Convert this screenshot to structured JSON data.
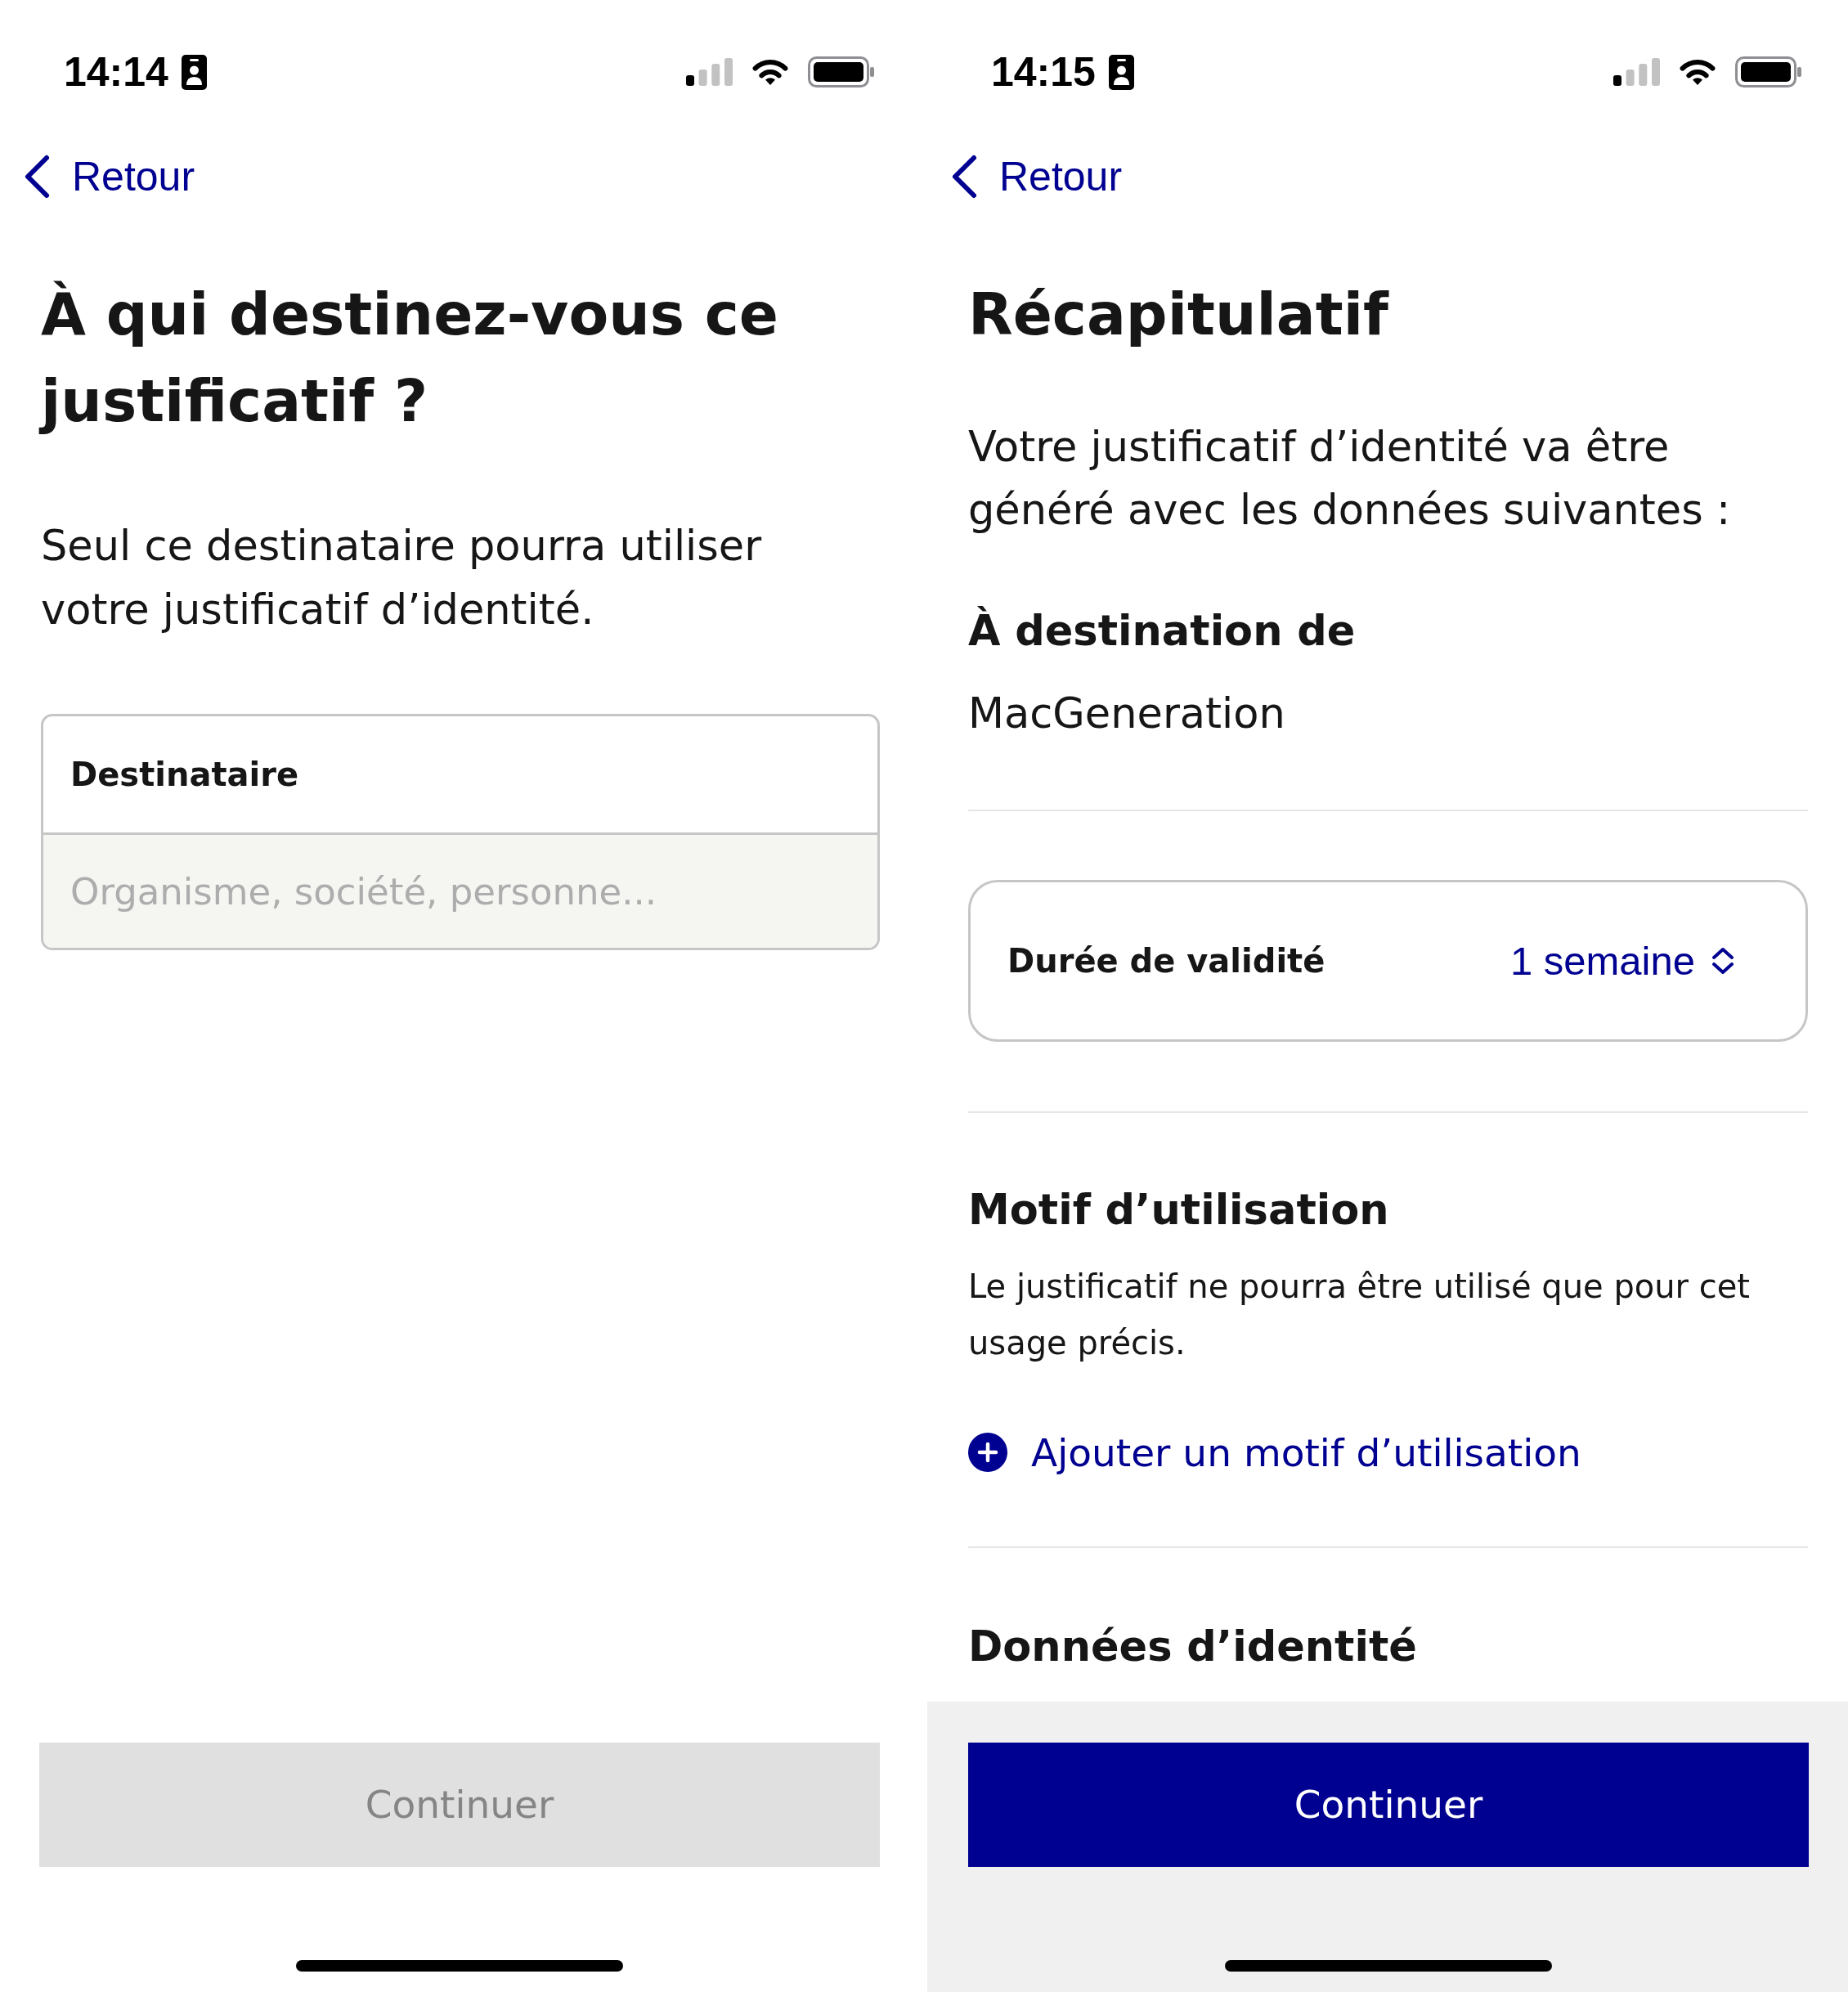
{
  "screens": [
    {
      "kind": "recipient_form",
      "status_bar": {
        "time": "14:14"
      },
      "back_link": "Retour",
      "title": "À qui destinez-vous ce justificatif ?",
      "description": "Seul ce destinataire pourra utiliser votre justificatif d’identité.",
      "field": {
        "label": "Destinataire",
        "placeholder": "Organisme, société, personne..."
      },
      "button": {
        "label": "Continuer",
        "disabled": true
      }
    },
    {
      "kind": "summary",
      "status_bar": {
        "time": "14:15"
      },
      "back_link": "Retour",
      "title": "Récapitulatif",
      "description": "Votre justificatif d’identité va être généré avec les données suivantes :",
      "recipient": {
        "heading": "À destination de",
        "value": "MacGeneration"
      },
      "validity": {
        "label": "Durée de validité",
        "value": "1 semaine"
      },
      "purpose": {
        "heading": "Motif d’utilisation",
        "text": "Le justificatif ne pourra être utilisé que pour cet usage précis.",
        "add_link": "Ajouter un motif d’utilisation"
      },
      "identity": {
        "heading": "Données d’identité"
      },
      "button": {
        "label": "Continuer",
        "disabled": false
      }
    }
  ]
}
